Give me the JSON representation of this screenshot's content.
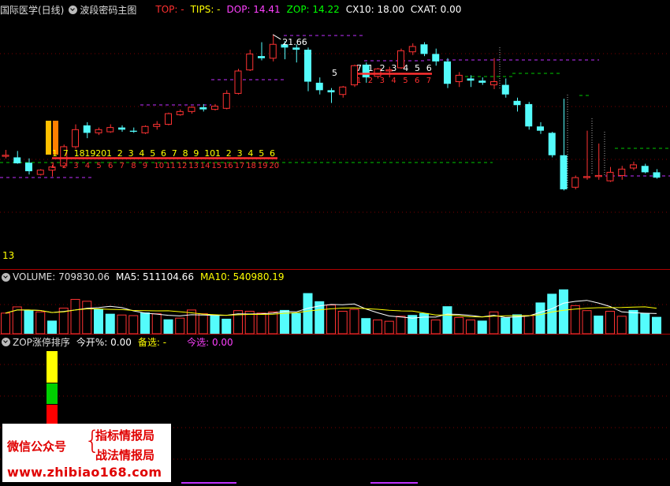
{
  "main_header": {
    "stock": "国际医学(日线)",
    "indicator": "波段密码主图",
    "items": [
      {
        "text": "TOP: -",
        "color": "#ff3030"
      },
      {
        "text": "TIPS: -",
        "color": "#ffff00"
      },
      {
        "text": "DOP: 14.41",
        "color": "#ff40ff"
      },
      {
        "text": "ZOP: 14.22",
        "color": "#00ff00"
      },
      {
        "text": "CX10: 18.00",
        "color": "#ffffff"
      },
      {
        "text": "CXAT: 0.00",
        "color": "#ffffff"
      }
    ]
  },
  "vol_header": {
    "items": [
      {
        "text": "VOLUME: 709830.06",
        "color": "#dddddd"
      },
      {
        "text": "MA5: 511104.66",
        "color": "#ffffff"
      },
      {
        "text": "MA10: 540980.19",
        "color": "#ffff00"
      }
    ]
  },
  "zop_header": {
    "items": [
      {
        "text": "ZOP涨停排序",
        "color": "#dddddd"
      },
      {
        "text": "今开%: 0.00",
        "color": "#ffffff"
      },
      {
        "text": "备选: -",
        "color": "#ffff00"
      },
      {
        "text": "今选: 0.00",
        "color": "#ff40ff"
      }
    ]
  },
  "chart_data": {
    "type": "candlestick",
    "peak_label": "21.66",
    "left_number": "13",
    "colors": {
      "up": "#ff3232",
      "down": "#54fcfc",
      "ma5": "#ffffff",
      "ma10": "#ffff00",
      "dash_green": "#00c800",
      "dash_magenta": "#c030ff"
    },
    "candles": [
      {
        "o": 15.95,
        "h": 16.25,
        "l": 15.85,
        "c": 16.0
      },
      {
        "o": 15.9,
        "h": 16.2,
        "l": 15.6,
        "c": 15.62
      },
      {
        "o": 15.65,
        "h": 15.85,
        "l": 15.1,
        "c": 15.25
      },
      {
        "o": 15.1,
        "h": 15.35,
        "l": 15.05,
        "c": 15.3
      },
      {
        "o": 15.3,
        "h": 15.55,
        "l": 15.0,
        "c": 15.45
      },
      {
        "o": 15.5,
        "h": 16.5,
        "l": 15.4,
        "c": 16.4
      },
      {
        "o": 16.4,
        "h": 17.45,
        "l": 16.3,
        "c": 17.2
      },
      {
        "o": 17.4,
        "h": 17.55,
        "l": 16.8,
        "c": 17.05
      },
      {
        "o": 17.05,
        "h": 17.3,
        "l": 16.95,
        "c": 17.2
      },
      {
        "o": 17.1,
        "h": 17.45,
        "l": 17.05,
        "c": 17.3
      },
      {
        "o": 17.3,
        "h": 17.4,
        "l": 17.1,
        "c": 17.2
      },
      {
        "o": 17.15,
        "h": 17.3,
        "l": 17.05,
        "c": 17.1
      },
      {
        "o": 17.05,
        "h": 17.4,
        "l": 17.0,
        "c": 17.35
      },
      {
        "o": 17.35,
        "h": 17.6,
        "l": 17.2,
        "c": 17.45
      },
      {
        "o": 17.45,
        "h": 18.0,
        "l": 17.4,
        "c": 17.95
      },
      {
        "o": 17.9,
        "h": 18.15,
        "l": 17.85,
        "c": 18.05
      },
      {
        "o": 18.05,
        "h": 18.3,
        "l": 17.95,
        "c": 18.25
      },
      {
        "o": 18.25,
        "h": 18.4,
        "l": 18.05,
        "c": 18.15
      },
      {
        "o": 18.15,
        "h": 18.4,
        "l": 18.1,
        "c": 18.3
      },
      {
        "o": 18.2,
        "h": 19.05,
        "l": 18.15,
        "c": 18.9
      },
      {
        "o": 18.9,
        "h": 20.05,
        "l": 18.85,
        "c": 19.95
      },
      {
        "o": 20.0,
        "h": 20.95,
        "l": 19.95,
        "c": 20.75
      },
      {
        "o": 20.65,
        "h": 21.3,
        "l": 20.45,
        "c": 20.55
      },
      {
        "o": 20.55,
        "h": 21.66,
        "l": 20.4,
        "c": 21.2
      },
      {
        "o": 21.2,
        "h": 21.35,
        "l": 20.5,
        "c": 21.05
      },
      {
        "o": 21.05,
        "h": 21.2,
        "l": 20.35,
        "c": 20.95
      },
      {
        "o": 20.95,
        "h": 21.05,
        "l": 19.0,
        "c": 19.45
      },
      {
        "o": 19.4,
        "h": 19.65,
        "l": 18.85,
        "c": 19.05
      },
      {
        "o": 19.05,
        "h": 19.15,
        "l": 18.45,
        "c": 18.95
      },
      {
        "o": 18.85,
        "h": 19.25,
        "l": 18.7,
        "c": 19.2
      },
      {
        "o": 19.3,
        "h": 20.25,
        "l": 19.2,
        "c": 20.2
      },
      {
        "o": 20.25,
        "h": 20.35,
        "l": 19.4,
        "c": 19.65
      },
      {
        "o": 19.7,
        "h": 20.1,
        "l": 19.6,
        "c": 20.05
      },
      {
        "o": 19.95,
        "h": 20.15,
        "l": 19.65,
        "c": 20.0
      },
      {
        "o": 20.1,
        "h": 21.0,
        "l": 20.05,
        "c": 20.9
      },
      {
        "o": 20.85,
        "h": 21.25,
        "l": 20.7,
        "c": 21.1
      },
      {
        "o": 21.2,
        "h": 21.3,
        "l": 20.65,
        "c": 20.75
      },
      {
        "o": 20.75,
        "h": 21.0,
        "l": 20.2,
        "c": 20.4
      },
      {
        "o": 20.4,
        "h": 20.55,
        "l": 19.15,
        "c": 19.35
      },
      {
        "o": 19.45,
        "h": 19.9,
        "l": 19.2,
        "c": 19.75
      },
      {
        "o": 19.6,
        "h": 19.75,
        "l": 19.2,
        "c": 19.5
      },
      {
        "o": 19.5,
        "h": 19.65,
        "l": 19.3,
        "c": 19.4
      },
      {
        "o": 19.3,
        "h": 20.55,
        "l": 19.1,
        "c": 19.45
      },
      {
        "o": 19.3,
        "h": 19.6,
        "l": 18.7,
        "c": 18.85
      },
      {
        "o": 18.55,
        "h": 18.7,
        "l": 18.05,
        "c": 18.35
      },
      {
        "o": 18.4,
        "h": 18.5,
        "l": 17.2,
        "c": 17.35
      },
      {
        "o": 17.35,
        "h": 17.55,
        "l": 17.0,
        "c": 17.15
      },
      {
        "o": 17.05,
        "h": 17.1,
        "l": 15.9,
        "c": 16.0
      },
      {
        "o": 16.0,
        "h": 18.65,
        "l": 14.35,
        "c": 14.4
      },
      {
        "o": 14.5,
        "h": 15.05,
        "l": 14.4,
        "c": 14.95
      },
      {
        "o": 14.95,
        "h": 17.15,
        "l": 14.85,
        "c": 15.0
      },
      {
        "o": 15.0,
        "h": 16.55,
        "l": 14.85,
        "c": 15.05
      },
      {
        "o": 14.8,
        "h": 15.45,
        "l": 14.75,
        "c": 15.2
      },
      {
        "o": 15.05,
        "h": 15.5,
        "l": 14.85,
        "c": 15.35
      },
      {
        "o": 15.4,
        "h": 15.7,
        "l": 15.3,
        "c": 15.55
      },
      {
        "o": 15.5,
        "h": 15.6,
        "l": 15.15,
        "c": 15.2
      },
      {
        "o": 15.2,
        "h": 15.35,
        "l": 14.9,
        "c": 14.95
      }
    ],
    "volume": [
      {
        "v": 330000,
        "up": true
      },
      {
        "v": 430000,
        "up": true
      },
      {
        "v": 380000,
        "up": false
      },
      {
        "v": 350000,
        "up": true
      },
      {
        "v": 210000,
        "up": false
      },
      {
        "v": 410000,
        "up": true
      },
      {
        "v": 550000,
        "up": true
      },
      {
        "v": 520000,
        "up": true
      },
      {
        "v": 400000,
        "up": false
      },
      {
        "v": 320000,
        "up": false
      },
      {
        "v": 300000,
        "up": true
      },
      {
        "v": 290000,
        "up": true
      },
      {
        "v": 340000,
        "up": false
      },
      {
        "v": 320000,
        "up": true
      },
      {
        "v": 230000,
        "up": false
      },
      {
        "v": 250000,
        "up": true
      },
      {
        "v": 380000,
        "up": true
      },
      {
        "v": 320000,
        "up": true
      },
      {
        "v": 290000,
        "up": false
      },
      {
        "v": 240000,
        "up": false
      },
      {
        "v": 370000,
        "up": true
      },
      {
        "v": 360000,
        "up": true
      },
      {
        "v": 330000,
        "up": true
      },
      {
        "v": 350000,
        "up": true
      },
      {
        "v": 380000,
        "up": false
      },
      {
        "v": 330000,
        "up": false
      },
      {
        "v": 650000,
        "up": false
      },
      {
        "v": 520000,
        "up": false
      },
      {
        "v": 460000,
        "up": true
      },
      {
        "v": 360000,
        "up": true
      },
      {
        "v": 390000,
        "up": true
      },
      {
        "v": 250000,
        "up": false
      },
      {
        "v": 220000,
        "up": true
      },
      {
        "v": 200000,
        "up": true
      },
      {
        "v": 280000,
        "up": true
      },
      {
        "v": 300000,
        "up": false
      },
      {
        "v": 330000,
        "up": false
      },
      {
        "v": 220000,
        "up": true
      },
      {
        "v": 440000,
        "up": false
      },
      {
        "v": 260000,
        "up": true
      },
      {
        "v": 220000,
        "up": true
      },
      {
        "v": 210000,
        "up": false
      },
      {
        "v": 350000,
        "up": true
      },
      {
        "v": 260000,
        "up": false
      },
      {
        "v": 310000,
        "up": false
      },
      {
        "v": 290000,
        "up": true
      },
      {
        "v": 500000,
        "up": false
      },
      {
        "v": 640000,
        "up": false
      },
      {
        "v": 710000,
        "up": false
      },
      {
        "v": 450000,
        "up": true
      },
      {
        "v": 370000,
        "up": true
      },
      {
        "v": 290000,
        "up": false
      },
      {
        "v": 360000,
        "up": true
      },
      {
        "v": 280000,
        "up": true
      },
      {
        "v": 380000,
        "up": false
      },
      {
        "v": 330000,
        "up": false
      },
      {
        "v": 270000,
        "up": false
      }
    ],
    "count_top_labels": [
      "1",
      "7",
      "18",
      "19",
      "20",
      "1",
      "2",
      "3",
      "4",
      "5",
      "6",
      "7",
      "8",
      "9",
      "10",
      "1",
      "2",
      "3",
      "4",
      "5",
      "6"
    ],
    "count_bottom_labels": [
      "1",
      "2",
      "3",
      "4",
      "5",
      "6",
      "7",
      "8",
      "9",
      "10",
      "11",
      "12",
      "13",
      "14",
      "15",
      "16",
      "17",
      "18",
      "19",
      "20"
    ],
    "count2_top_labels": [
      "7",
      "1",
      "2",
      "3",
      "4",
      "5",
      "6"
    ],
    "count2_bottom_labels": [
      "1",
      "2",
      "3",
      "4",
      "5",
      "6",
      "7"
    ],
    "mark_5": "5",
    "mark_7": "7"
  },
  "watermark": {
    "line1": "微信公众号",
    "brace": "{",
    "right1": "指标情报局",
    "right2": "战法情报局",
    "url": "www.zhibiao168.com"
  }
}
